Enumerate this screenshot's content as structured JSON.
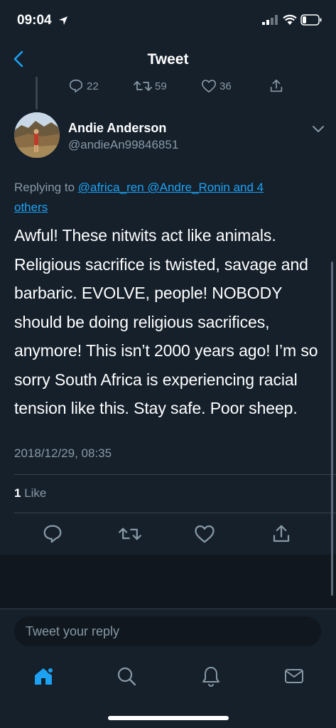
{
  "status_bar": {
    "time": "09:04"
  },
  "nav": {
    "title": "Tweet"
  },
  "previous_tweet_actions": {
    "replies": "22",
    "retweets": "59",
    "likes": "36"
  },
  "tweet": {
    "author_name": "Andie Anderson",
    "author_handle": "@andieAn99846851",
    "replying_prefix": "Replying to",
    "replying_mentions": "@africa_ren @Andre_Ronin and 4 others",
    "text": "Awful! These nitwits act like animals. Religious sacrifice is twisted, savage and barbaric. EVOLVE, people! NOBODY should be doing religious sacrifices, anymore! This isn’t 2000 years ago! I’m so sorry South Africa is experiencing racial tension like this. Stay safe. Poor sheep.",
    "timestamp": "2018/12/29, 08:35",
    "like_count": "1",
    "like_label": "Like"
  },
  "reply": {
    "placeholder": "Tweet your reply"
  },
  "tabs": [
    "home-icon",
    "search-icon",
    "notifications-icon",
    "messages-icon"
  ],
  "colors": {
    "background": "#15202b",
    "accent": "#1da1f2",
    "secondary_text": "#8899a6",
    "divider": "#38444d"
  }
}
